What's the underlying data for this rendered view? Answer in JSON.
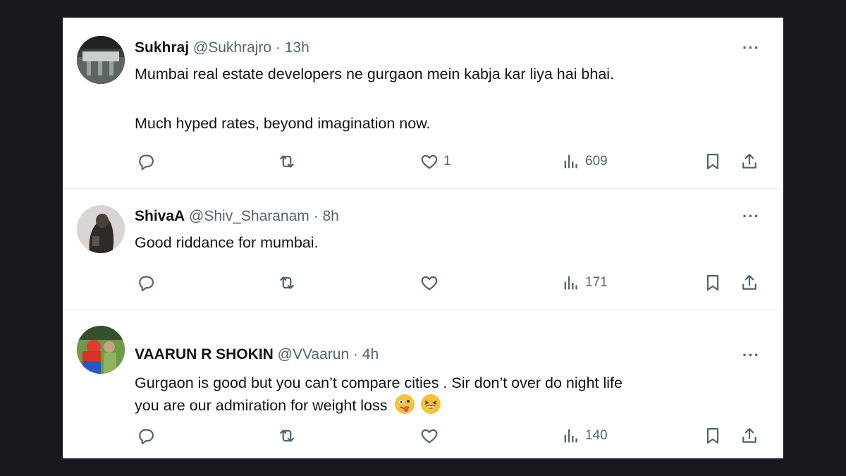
{
  "tweets": [
    {
      "name": "Sukhraj",
      "handle": "@Sukhrajro",
      "time": "· 13h",
      "lines": [
        "Mumbai real estate developers ne gurgaon mein kabja kar liya hai bhai.",
        "",
        "Much hyped rates, beyond imagination now."
      ],
      "likes": "1",
      "views": "609"
    },
    {
      "name": "ShivaA",
      "handle": "@Shiv_Sharanam",
      "time": "· 8h",
      "lines": [
        "Good riddance for mumbai."
      ],
      "likes": "",
      "views": "171"
    },
    {
      "name": "VAARUN R SHOKIN",
      "handle": "@VVaarun",
      "time": "· 4h",
      "lines": [
        "Gurgaon is good but you can’t compare cities . Sir don’t over do night life",
        "you are our admiration for weight loss"
      ],
      "likes": "",
      "views": "140"
    }
  ],
  "more_label": "···"
}
